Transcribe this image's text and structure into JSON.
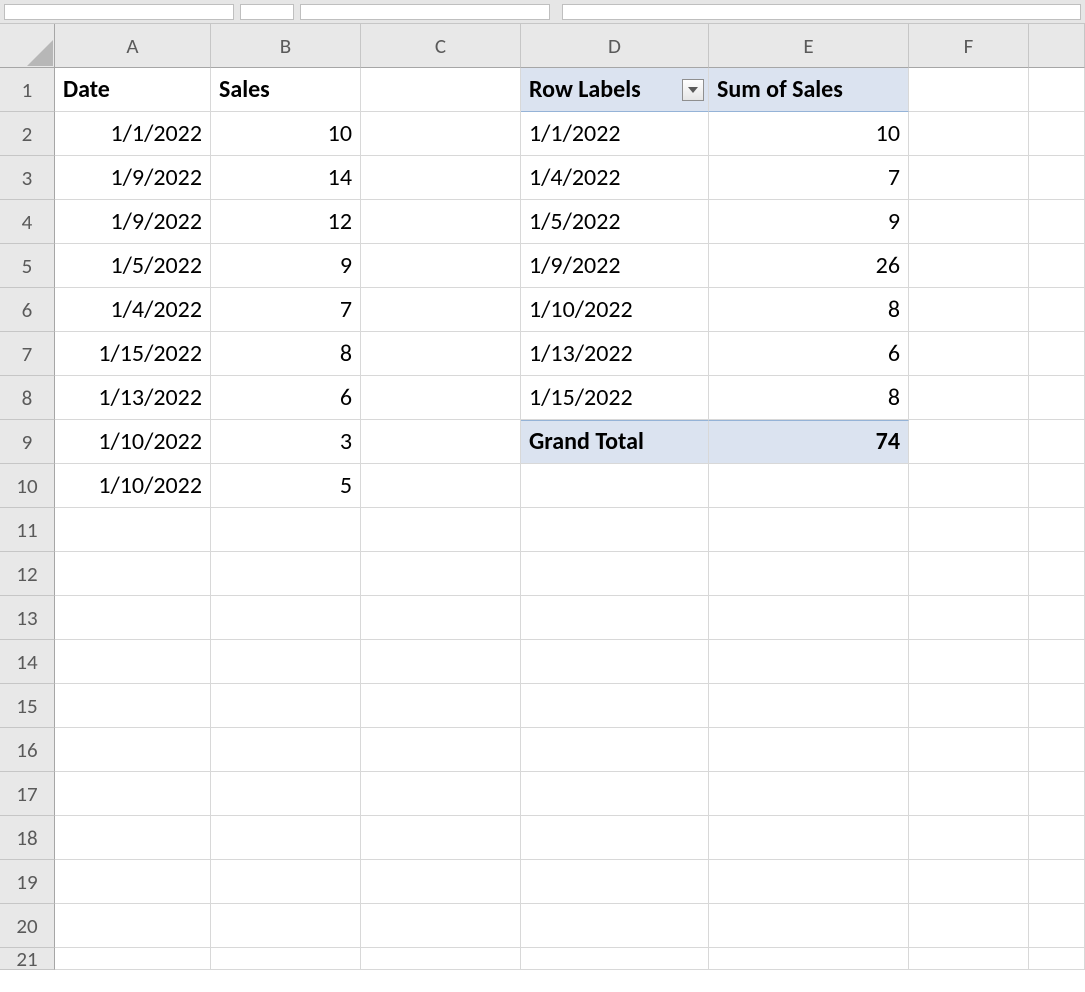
{
  "columns": [
    "A",
    "B",
    "C",
    "D",
    "E",
    "F",
    ""
  ],
  "rows": [
    "1",
    "2",
    "3",
    "4",
    "5",
    "6",
    "7",
    "8",
    "9",
    "10",
    "11",
    "12",
    "13",
    "14",
    "15",
    "16",
    "17",
    "18",
    "19",
    "20",
    "21"
  ],
  "sourceHeaders": {
    "date": "Date",
    "sales": "Sales"
  },
  "source": [
    {
      "date": "1/1/2022",
      "sales": "10"
    },
    {
      "date": "1/9/2022",
      "sales": "14"
    },
    {
      "date": "1/9/2022",
      "sales": "12"
    },
    {
      "date": "1/5/2022",
      "sales": "9"
    },
    {
      "date": "1/4/2022",
      "sales": "7"
    },
    {
      "date": "1/15/2022",
      "sales": "8"
    },
    {
      "date": "1/13/2022",
      "sales": "6"
    },
    {
      "date": "1/10/2022",
      "sales": "3"
    },
    {
      "date": "1/10/2022",
      "sales": "5"
    }
  ],
  "pivot": {
    "rowLabelsHeader": "Row Labels",
    "valueHeader": "Sum of Sales",
    "rows": [
      {
        "label": "1/1/2022",
        "value": "10"
      },
      {
        "label": "1/4/2022",
        "value": "7"
      },
      {
        "label": "1/5/2022",
        "value": "9"
      },
      {
        "label": "1/9/2022",
        "value": "26"
      },
      {
        "label": "1/10/2022",
        "value": "8"
      },
      {
        "label": "1/13/2022",
        "value": "6"
      },
      {
        "label": "1/15/2022",
        "value": "8"
      }
    ],
    "grandTotalLabel": "Grand Total",
    "grandTotalValue": "74"
  }
}
